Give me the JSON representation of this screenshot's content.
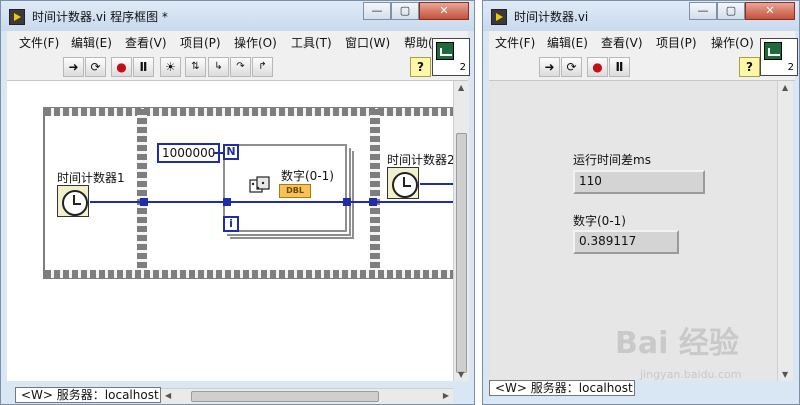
{
  "block_diagram_window": {
    "title": "时间计数器.vi 程序框图 *",
    "menu": [
      "文件(F)",
      "编辑(E)",
      "查看(V)",
      "项目(P)",
      "操作(O)",
      "工具(T)",
      "窗口(W)",
      "帮助("
    ],
    "toolbar_icons": [
      "run-continuously",
      "refresh",
      "abort",
      "pause",
      "highlight-execution",
      "retain-wire-values",
      "step-into",
      "step-over",
      "step-out",
      "help"
    ],
    "connector_number": "2",
    "diagram": {
      "timer1_label": "时间计数器1",
      "timer2_label": "时间计数器2",
      "loop_count_constant": "1000000",
      "count_terminal": "N",
      "iteration_terminal": "i",
      "random_output_label": "数字(0-1)",
      "dbl_indicator": "DBL"
    },
    "status_text": "<W> 服务器：localhost"
  },
  "front_panel_window": {
    "title": "时间计数器.vi",
    "menu": [
      "文件(F)",
      "编辑(E)",
      "查看(V)",
      "项目(P)",
      "操作(O)"
    ],
    "connector_number": "2",
    "indicators": [
      {
        "label": "运行时间差ms",
        "value": "110"
      },
      {
        "label": "数字(0-1)",
        "value": "0.389117"
      }
    ],
    "status_text": "<W> 服务器：localhost"
  },
  "watermark": {
    "brand": "Bai 经验",
    "url": "jingyan.baidu.com"
  }
}
